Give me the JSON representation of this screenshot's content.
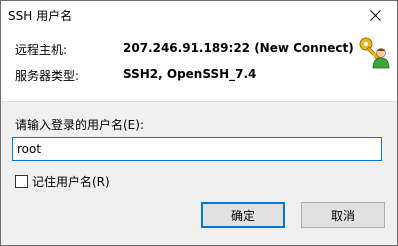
{
  "window": {
    "title": "SSH 用户名",
    "close_glyph": "✕"
  },
  "info": {
    "remote_host_label": "远程主机:",
    "remote_host_value": "207.246.91.189:22 (New Connect)",
    "server_type_label": "服务器类型:",
    "server_type_value": "SSH2, OpenSSH_7.4",
    "icon": "keys-user-icon"
  },
  "form": {
    "prompt": "请输入登录的用户名(E):",
    "username_value": "root",
    "remember_label": "记住用户名(R)",
    "remember_checked": false
  },
  "buttons": {
    "ok_label": "确定",
    "cancel_label": "取消"
  },
  "colors": {
    "accent": "#0078d7",
    "panel_bg": "#ffffff",
    "dialog_bg": "#f0f0f0"
  }
}
